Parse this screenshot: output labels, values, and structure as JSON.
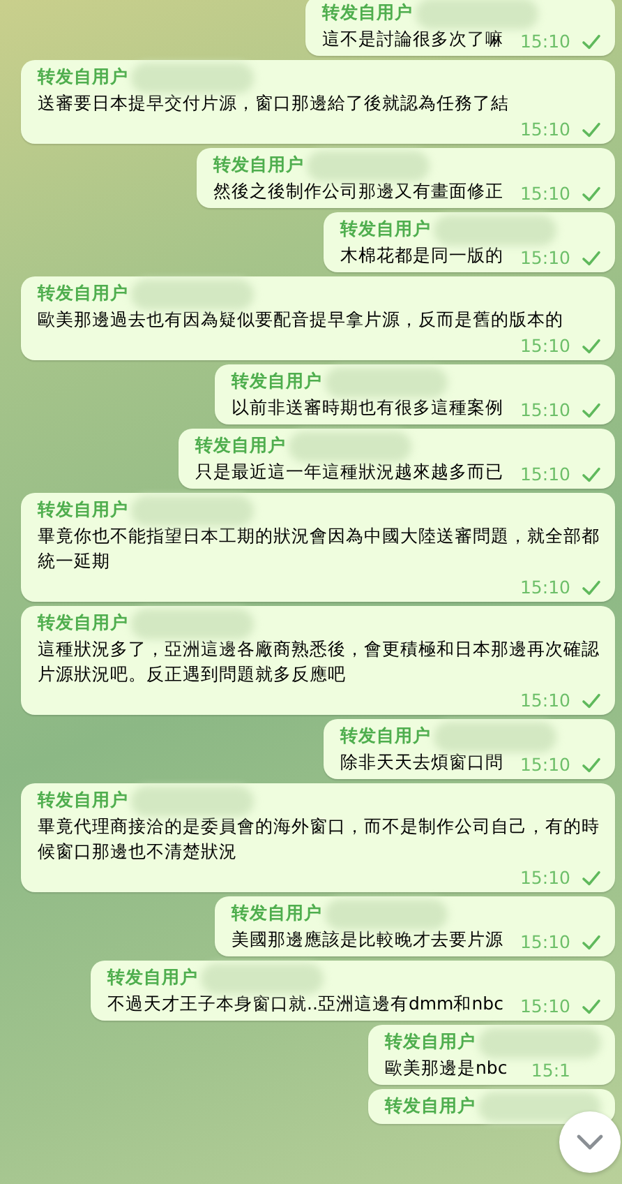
{
  "messages": [
    {
      "header": "转发自用户",
      "text": "這不是討論很多次了嘛",
      "time": "15:10",
      "tick": true
    },
    {
      "header": "转发自用户",
      "text": "送審要日本提早交付片源，窗口那邊給了後就認為任務了結",
      "time": "15:10",
      "tick": true
    },
    {
      "header": "转发自用户",
      "text": "然後之後制作公司那邊又有畫面修正",
      "time": "15:10",
      "tick": true
    },
    {
      "header": "转发自用户",
      "text": "木棉花都是同一版的",
      "time": "15:10",
      "tick": true
    },
    {
      "header": "转发自用户",
      "text": "歐美那邊過去也有因為疑似要配音提早拿片源，反而是舊的版本的",
      "time": "15:10",
      "tick": true
    },
    {
      "header": "转发自用户",
      "text": "以前非送審時期也有很多這種案例",
      "time": "15:10",
      "tick": true
    },
    {
      "header": "转发自用户",
      "text": "只是最近這一年這種狀況越來越多而已",
      "time": "15:10",
      "tick": true
    },
    {
      "header": "转发自用户",
      "text": "畢竟你也不能指望日本工期的狀況會因為中國大陸送審問題，就全部都統一延期",
      "time": "15:10",
      "tick": true
    },
    {
      "header": "转发自用户",
      "text": "這種狀況多了，亞洲這邊各廠商熟悉後，會更積極和日本那邊再次確認片源狀況吧。反正遇到問題就多反應吧",
      "time": "15:10",
      "tick": true
    },
    {
      "header": "转发自用户",
      "text": "除非天天去煩窗口問",
      "time": "15:10",
      "tick": true
    },
    {
      "header": "转发自用户",
      "text": "畢竟代理商接洽的是委員會的海外窗口，而不是制作公司自己，有的時候窗口那邊也不清楚狀況",
      "time": "15:10",
      "tick": true
    },
    {
      "header": "转发自用户",
      "text": "美國那邊應該是比較晚才去要片源",
      "time": "15:10",
      "tick": true
    },
    {
      "header": "转发自用户",
      "text": "不過天才王子本身窗口就..亞洲這邊有dmm和nbc",
      "time": "15:10",
      "tick": true
    },
    {
      "header": "转发自用户",
      "text": "歐美那邊是nbc",
      "time": "15:1",
      "tick": false
    },
    {
      "header": "转发自用户"
    }
  ]
}
